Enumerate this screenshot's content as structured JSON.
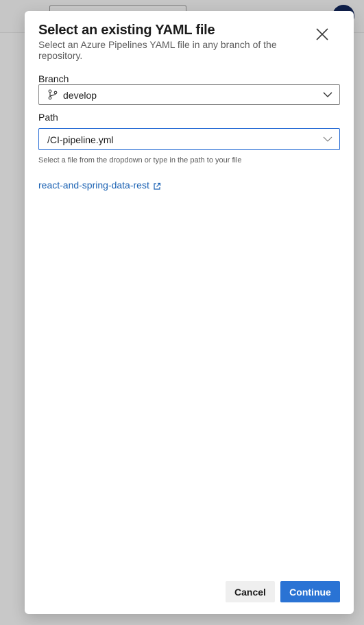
{
  "dialog": {
    "title": "Select an existing YAML file",
    "subtitle": "Select an Azure Pipelines YAML file in any branch of the repository.",
    "branch": {
      "label": "Branch",
      "value": "develop",
      "icon": "branch-icon"
    },
    "path": {
      "label": "Path",
      "value": "/CI-pipeline.yml",
      "help": "Select a file from the dropdown or type in the path to your file"
    },
    "repo_link": {
      "text": "react-and-spring-data-rest",
      "icon": "external-link-icon"
    },
    "buttons": {
      "cancel": "Cancel",
      "continue": "Continue"
    }
  },
  "colors": {
    "accent": "#2a73d4",
    "link": "#1b62b3",
    "overlay": "#c8c8c8"
  }
}
